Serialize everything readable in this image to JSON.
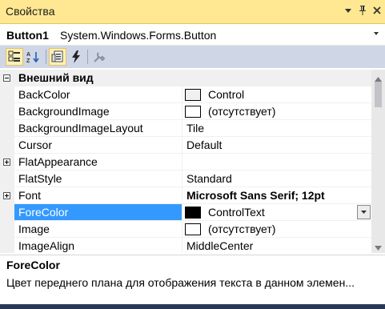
{
  "window": {
    "title": "Свойства",
    "buttons": {
      "dropdown_icon": "dropdown-triangle-icon",
      "pin_icon": "pin-icon",
      "close_icon": "close-icon"
    }
  },
  "object_selector": {
    "name": "Button1",
    "type": "System.Windows.Forms.Button"
  },
  "toolbar": {
    "items": [
      {
        "icon": "categorized-icon",
        "active": true
      },
      {
        "icon": "alphabetical-icon",
        "active": false
      },
      {
        "icon": "properties-icon",
        "active": true
      },
      {
        "icon": "events-icon",
        "active": false
      },
      {
        "icon": "property-pages-icon",
        "active": false
      }
    ]
  },
  "grid": {
    "category": {
      "label": "Внешний вид",
      "expanded": true
    },
    "rows": [
      {
        "name": "BackColor",
        "value": "Control",
        "swatch": "#f0f0f0"
      },
      {
        "name": "BackgroundImage",
        "value": "(отсутствует)",
        "swatch": "#ffffff"
      },
      {
        "name": "BackgroundImageLayout",
        "value": "Tile"
      },
      {
        "name": "Cursor",
        "value": "Default"
      },
      {
        "name": "FlatAppearance",
        "value": "",
        "expandable": true
      },
      {
        "name": "FlatStyle",
        "value": "Standard"
      },
      {
        "name": "Font",
        "value": "Microsoft Sans Serif; 12pt",
        "expandable": true,
        "bold_value": true
      },
      {
        "name": "ForeColor",
        "value": "ControlText",
        "swatch": "#000000",
        "selected": true,
        "dropdown": true
      },
      {
        "name": "Image",
        "value": "(отсутствует)",
        "swatch": "#ffffff"
      },
      {
        "name": "ImageAlign",
        "value": "MiddleCenter"
      }
    ]
  },
  "description": {
    "title": "ForeColor",
    "text": "Цвет переднего плана для отображения текста в данном элемен..."
  },
  "colors": {
    "title_bar": "#ffe891",
    "toolbar": "#cfd6e5",
    "selection": "#3399ff",
    "gutter": "#f0f0f0"
  }
}
